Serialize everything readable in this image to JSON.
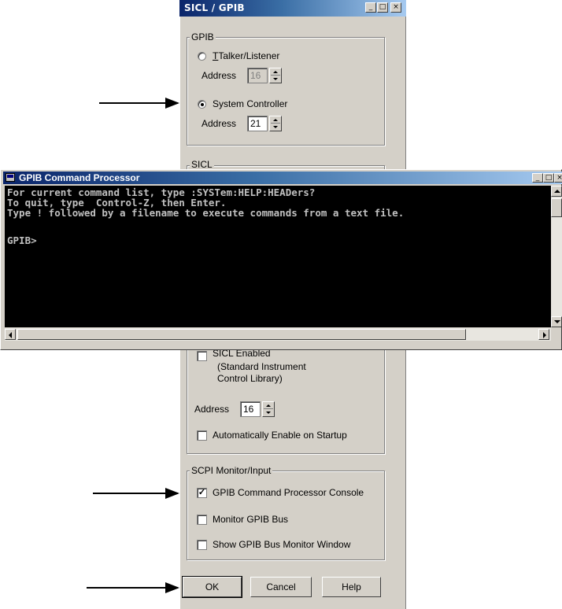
{
  "dialog": {
    "title": "SICL / GPIB",
    "gpib_group": {
      "label": "GPIB",
      "talker_listener": {
        "label": "Talker/Listener",
        "selected": false,
        "address_label": "Address",
        "address_value": "16"
      },
      "system_controller": {
        "label": "System Controller",
        "selected": true,
        "address_label": "Address",
        "address_value": "21"
      }
    },
    "sicl_group": {
      "label": "SICL",
      "enabled_label_partial": "SICL Enabled",
      "desc_line1": "(Standard Instrument",
      "desc_line2": "Control Library)",
      "address_label": "Address",
      "address_value": "16",
      "auto_enable_label": "Automatically Enable on Startup",
      "auto_enable_checked": false
    },
    "scpi_group": {
      "label": "SCPI Monitor/Input",
      "console_label": "GPIB Command Processor Console",
      "console_checked": true,
      "monitor_bus_label": "Monitor GPIB Bus",
      "monitor_bus_checked": false,
      "show_window_label": "Show GPIB Bus Monitor Window",
      "show_window_checked": false
    },
    "buttons": {
      "ok": "OK",
      "cancel": "Cancel",
      "help": "Help"
    }
  },
  "console": {
    "title": "GPIB Command Processor",
    "lines": [
      "For current command list, type :SYSTem:HELP:HEADers?",
      "To quit, type  Control-Z, then Enter.",
      "Type ! followed by a filename to execute commands from a text file.",
      "",
      "GPIB>"
    ]
  },
  "colors": {
    "dialog_bg": "#d4d0c8",
    "titlebar_start": "#0a246a",
    "titlebar_end": "#a6caf0",
    "console_bg": "#000000",
    "console_text": "#c0c0c0"
  }
}
